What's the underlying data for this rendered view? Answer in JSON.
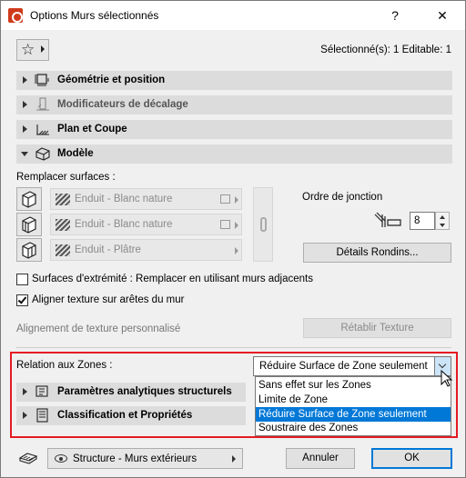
{
  "window": {
    "title": "Options Murs sélectionnés",
    "help_glyph": "?",
    "close_glyph": "✕"
  },
  "toolbar": {
    "favorites_glyph": "☆",
    "selection_info": "Sélectionné(s): 1 Editable: 1"
  },
  "panels": {
    "geometry": "Géométrie et position",
    "offset": "Modificateurs de décalage",
    "plan": "Plan et Coupe",
    "model": "Modèle",
    "structural": "Paramètres analytiques structurels",
    "classification": "Classification et Propriétés"
  },
  "model": {
    "override_surfaces_label": "Remplacer surfaces :",
    "surfaces": [
      "Enduit - Blanc nature",
      "Enduit - Blanc nature",
      "Enduit - Plâtre"
    ],
    "junction_order_label": "Ordre de jonction",
    "junction_order_value": "8",
    "log_details_button": "Détails Rondins...",
    "end_surfaces_label": "Surfaces d'extrémité : Remplacer en utilisant murs adjacents",
    "end_surfaces_checked": false,
    "align_texture_label": "Aligner texture sur arêtes du mur",
    "align_texture_checked": true,
    "custom_texture_label": "Alignement de texture personnalisé",
    "reset_texture_button": "Rétablir Texture"
  },
  "zones": {
    "label": "Relation aux Zones :",
    "selected": "Réduire Surface de Zone seulement",
    "options": [
      "Sans effet sur les Zones",
      "Limite de Zone",
      "Réduire Surface de Zone seulement",
      "Soustraire des Zones"
    ],
    "highlighted_index": 2,
    "border_color": "#e51a24",
    "highlight_color": "#0078d7"
  },
  "footer": {
    "layer": "Structure - Murs extérieurs",
    "cancel": "Annuler",
    "ok": "OK"
  }
}
